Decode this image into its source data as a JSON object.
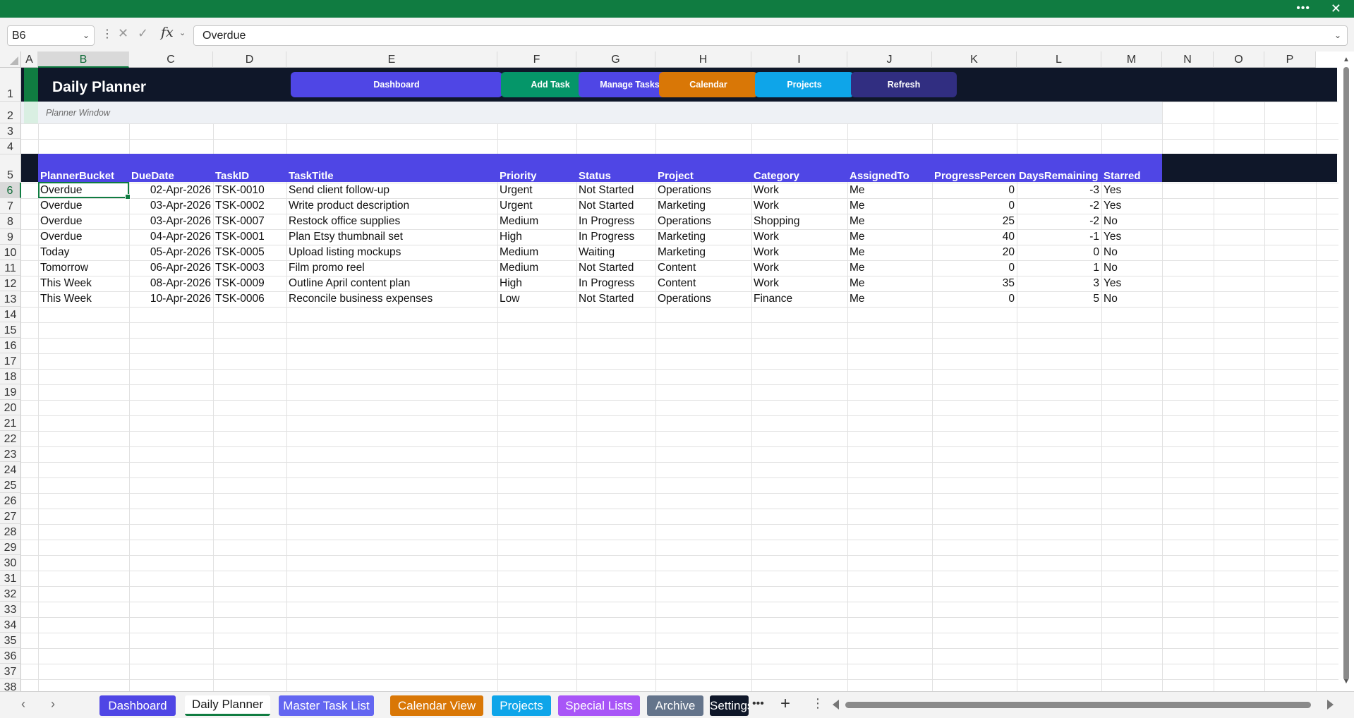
{
  "window": {
    "more_label": "•••",
    "close_label": "✕"
  },
  "formula_bar": {
    "name_box": "B6",
    "formula_value": "Overdue",
    "fx_label": "fx"
  },
  "columns": [
    "A",
    "B",
    "C",
    "D",
    "E",
    "F",
    "G",
    "H",
    "I",
    "J",
    "K",
    "L",
    "M",
    "N",
    "O",
    "P"
  ],
  "rows": [
    "1",
    "2",
    "3",
    "4",
    "5",
    "6",
    "7",
    "8",
    "9",
    "10",
    "11",
    "12",
    "13",
    "14",
    "15",
    "16",
    "17",
    "18",
    "19",
    "20",
    "21",
    "22",
    "23",
    "24",
    "25",
    "26",
    "27",
    "28",
    "29",
    "30",
    "31",
    "32",
    "33",
    "34",
    "35",
    "36",
    "37",
    "38"
  ],
  "planner": {
    "title": "Daily Planner",
    "subtitle": "Planner Window",
    "nav_buttons": [
      {
        "label": "Dashboard",
        "color": "#4f46e5"
      },
      {
        "label": "Add Task",
        "color": "#059669"
      },
      {
        "label": "Manage Tasks",
        "color": "#4f46e5"
      },
      {
        "label": "Calendar",
        "color": "#d97706"
      },
      {
        "label": "Projects",
        "color": "#0ea5e9"
      },
      {
        "label": "Refresh",
        "color": "#312e81"
      }
    ]
  },
  "table": {
    "headers": [
      "PlannerBucket",
      "DueDate",
      "TaskID",
      "TaskTitle",
      "Priority",
      "Status",
      "Project",
      "Category",
      "AssignedTo",
      "ProgressPercent",
      "DaysRemaining",
      "Starred"
    ],
    "rows": [
      [
        "Overdue",
        "02-Apr-2026",
        "TSK-0010",
        "Send client follow-up",
        "Urgent",
        "Not Started",
        "Operations",
        "Work",
        "Me",
        "0",
        "-3",
        "Yes"
      ],
      [
        "Overdue",
        "03-Apr-2026",
        "TSK-0002",
        "Write product description",
        "Urgent",
        "Not Started",
        "Marketing",
        "Work",
        "Me",
        "0",
        "-2",
        "Yes"
      ],
      [
        "Overdue",
        "03-Apr-2026",
        "TSK-0007",
        "Restock office supplies",
        "Medium",
        "In Progress",
        "Operations",
        "Shopping",
        "Me",
        "25",
        "-2",
        "No"
      ],
      [
        "Overdue",
        "04-Apr-2026",
        "TSK-0001",
        "Plan Etsy thumbnail set",
        "High",
        "In Progress",
        "Marketing",
        "Work",
        "Me",
        "40",
        "-1",
        "Yes"
      ],
      [
        "Today",
        "05-Apr-2026",
        "TSK-0005",
        "Upload listing mockups",
        "Medium",
        "Waiting",
        "Marketing",
        "Work",
        "Me",
        "20",
        "0",
        "No"
      ],
      [
        "Tomorrow",
        "06-Apr-2026",
        "TSK-0003",
        "Film promo reel",
        "Medium",
        "Not Started",
        "Content",
        "Work",
        "Me",
        "0",
        "1",
        "No"
      ],
      [
        "This Week",
        "08-Apr-2026",
        "TSK-0009",
        "Outline April content plan",
        "High",
        "In Progress",
        "Content",
        "Work",
        "Me",
        "35",
        "3",
        "Yes"
      ],
      [
        "This Week",
        "10-Apr-2026",
        "TSK-0006",
        "Reconcile business expenses",
        "Low",
        "Not Started",
        "Operations",
        "Finance",
        "Me",
        "0",
        "5",
        "No"
      ]
    ]
  },
  "sheet_tabs": [
    {
      "label": "Dashboard",
      "color": "#4f46e5",
      "active": false
    },
    {
      "label": "Daily Planner",
      "color": "#ffffff",
      "active": true
    },
    {
      "label": "Master Task List",
      "color": "#6366f1",
      "active": false
    },
    {
      "label": "Calendar View",
      "color": "#d97706",
      "active": false
    },
    {
      "label": "Projects",
      "color": "#0ea5e9",
      "active": false
    },
    {
      "label": "Special Lists",
      "color": "#a855f7",
      "active": false
    },
    {
      "label": "Archive",
      "color": "#64748b",
      "active": false
    },
    {
      "label": "Settings",
      "color": "#0f1729",
      "active": false
    }
  ],
  "tab_controls": {
    "more": "•••",
    "add": "+",
    "menu": "⋮",
    "prev": "‹",
    "next": "›"
  }
}
